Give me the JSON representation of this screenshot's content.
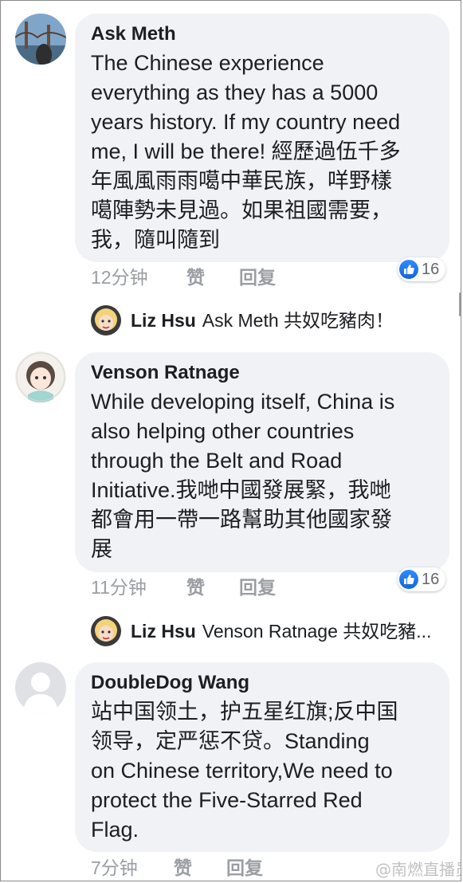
{
  "comments": [
    {
      "author": "Ask Meth",
      "text": "The Chinese experience\neverything as they has a 5000\nyears history. If my country need\nme, I will be there! 經歷過伍千多\n年風風雨雨噶中華民族，咩野樣\n噶陣勢未見過。如果祖國需要，\n我，隨叫隨到",
      "time": "12分钟",
      "like_label": "赞",
      "reply_label": "回复",
      "reaction_count": "16",
      "reply": {
        "author": "Liz Hsu",
        "text": "Ask Meth 共奴吃豬肉！"
      }
    },
    {
      "author": "Venson Ratnage",
      "text": "While developing itself, China is\nalso helping other countries\nthrough the Belt and Road\nInitiative.我哋中國發展緊，我哋\n都會用一帶一路幫助其他國家發\n展",
      "time": "11分钟",
      "like_label": "赞",
      "reply_label": "回复",
      "reaction_count": "16",
      "reply": {
        "author": "Liz Hsu",
        "text": "Venson Ratnage 共奴吃豬..."
      }
    },
    {
      "author": "DoubleDog Wang",
      "text": "站中国领土，护五星红旗;反中国\n领导，定严惩不贷。Standing\non Chinese territory,We need to\nprotect the Five-Starred Red\nFlag.",
      "time": "7分钟",
      "like_label": "赞",
      "reply_label": "回复"
    }
  ],
  "watermark": "@南燃直播员",
  "colors": {
    "like_blue": "#1877f2",
    "bubble": "#f0f2f5",
    "meta": "#9a9ea3"
  }
}
